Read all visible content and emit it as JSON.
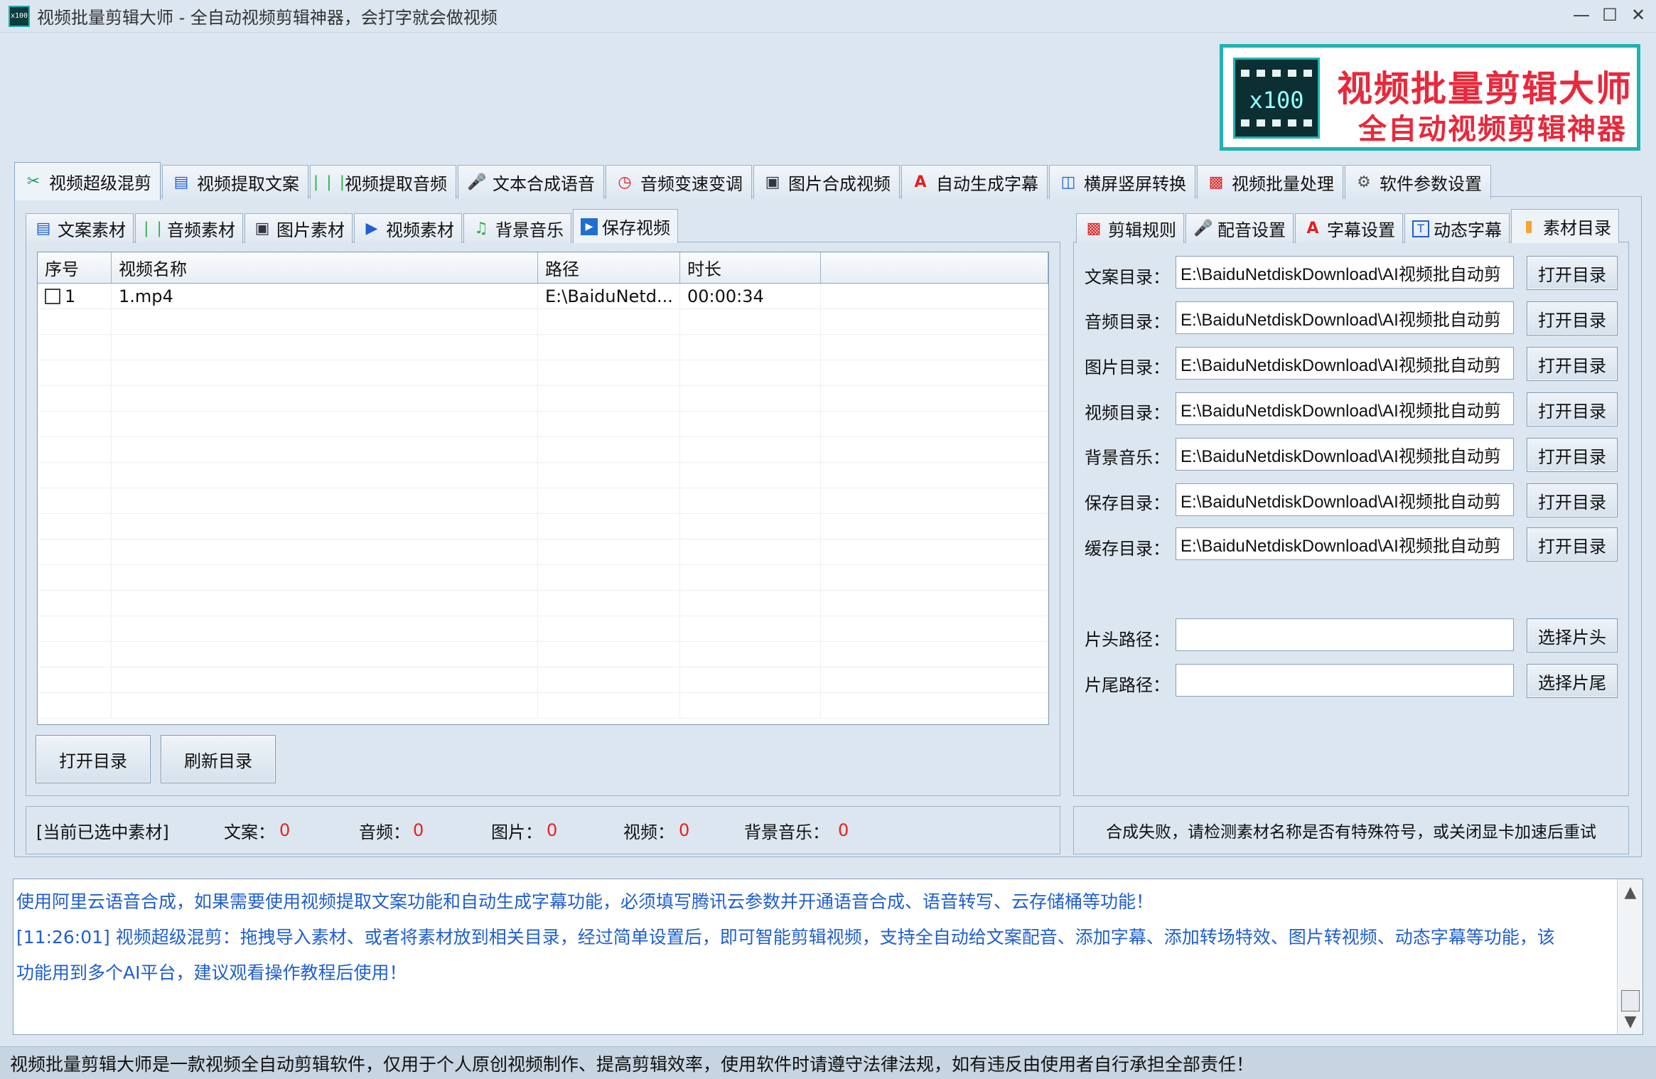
{
  "window": {
    "title": "视频批量剪辑大师 - 全自动视频剪辑神器，会打字就会做视频",
    "icon_text": "x100"
  },
  "logo": {
    "badge": "x100",
    "title": "视频批量剪辑大师",
    "subtitle": "全自动视频剪辑神器"
  },
  "main_tabs": [
    {
      "label": "视频超级混剪",
      "icon": "scissors-icon",
      "active": true
    },
    {
      "label": "视频提取文案",
      "icon": "document-icon"
    },
    {
      "label": "视频提取音频",
      "icon": "waveform-icon"
    },
    {
      "label": "文本合成语音",
      "icon": "microphone-icon"
    },
    {
      "label": "音频变速变调",
      "icon": "speedometer-icon"
    },
    {
      "label": "图片合成视频",
      "icon": "image-icon"
    },
    {
      "label": "自动生成字幕",
      "icon": "font-icon"
    },
    {
      "label": "横屏竖屏转换",
      "icon": "rotate-screen-icon"
    },
    {
      "label": "视频批量处理",
      "icon": "film-icon"
    },
    {
      "label": "软件参数设置",
      "icon": "gear-icon"
    }
  ],
  "sub_tabs": [
    {
      "label": "文案素材",
      "icon": "document-icon"
    },
    {
      "label": "音频素材",
      "icon": "waveform-icon"
    },
    {
      "label": "图片素材",
      "icon": "image-icon"
    },
    {
      "label": "视频素材",
      "icon": "play-icon"
    },
    {
      "label": "背景音乐",
      "icon": "music-note-icon"
    },
    {
      "label": "保存视频",
      "icon": "play-box-icon",
      "active": true
    }
  ],
  "table": {
    "columns": [
      "序号",
      "视频名称",
      "路径",
      "时长",
      ""
    ],
    "rows": [
      {
        "index": "1",
        "name": "1.mp4",
        "path": "E:\\BaiduNetd...",
        "duration": "00:00:34"
      }
    ]
  },
  "left_buttons": {
    "open_dir": "打开目录",
    "refresh_dir": "刷新目录"
  },
  "selected_bar": {
    "title": "[当前已选中素材]",
    "copy_label": "文案：",
    "copy_value": "0",
    "audio_label": "音频：",
    "audio_value": "0",
    "image_label": "图片：",
    "image_value": "0",
    "video_label": "视频：",
    "video_value": "0",
    "bgm_label": "背景音乐：",
    "bgm_value": "0"
  },
  "right_tabs": [
    {
      "label": "剪辑规则",
      "icon": "film-icon"
    },
    {
      "label": "配音设置",
      "icon": "microphone-icon"
    },
    {
      "label": "字幕设置",
      "icon": "font-icon"
    },
    {
      "label": "动态字幕",
      "icon": "text-box-icon"
    },
    {
      "label": "素材目录",
      "icon": "folder-icon",
      "active": true
    }
  ],
  "directories": [
    {
      "label": "文案目录：",
      "value": "E:\\BaiduNetdiskDownload\\AI视频批自动剪",
      "button": "打开目录"
    },
    {
      "label": "音频目录：",
      "value": "E:\\BaiduNetdiskDownload\\AI视频批自动剪",
      "button": "打开目录"
    },
    {
      "label": "图片目录：",
      "value": "E:\\BaiduNetdiskDownload\\AI视频批自动剪",
      "button": "打开目录"
    },
    {
      "label": "视频目录：",
      "value": "E:\\BaiduNetdiskDownload\\AI视频批自动剪",
      "button": "打开目录"
    },
    {
      "label": "背景音乐：",
      "value": "E:\\BaiduNetdiskDownload\\AI视频批自动剪",
      "button": "打开目录"
    },
    {
      "label": "保存目录：",
      "value": "E:\\BaiduNetdiskDownload\\AI视频批自动剪",
      "button": "打开目录"
    },
    {
      "label": "缓存目录：",
      "value": "E:\\BaiduNetdiskDownload\\AI视频批自动剪",
      "button": "打开目录"
    }
  ],
  "clips": [
    {
      "label": "片头路径：",
      "value": "",
      "button": "选择片头"
    },
    {
      "label": "片尾路径：",
      "value": "",
      "button": "选择片尾"
    }
  ],
  "status_right": "合成失败，请检测素材名称是否有特殊符号，或关闭显卡加速后重试",
  "log": {
    "line1": "使用阿里云语音合成，如果需要使用视频提取文案功能和自动生成字幕功能，必须填写腾讯云参数并开通语音合成、语音转写、云存储桶等功能！",
    "line2": "[11:26:01] 视频超级混剪：拖拽导入素材、或者将素材放到相关目录，经过简单设置后，即可智能剪辑视频，支持全自动给文案配音、添加字幕、添加转场特效、图片转视频、动态字幕等功能，该",
    "line3": "功能用到多个AI平台，建议观看操作教程后使用！"
  },
  "footer": "视频批量剪辑大师是一款视频全自动剪辑软件，仅用于个人原创视频制作、提高剪辑效率，使用软件时请遵守法律法规，如有违反由使用者自行承担全部责任！",
  "colors": {
    "accent": "#1fb3b3",
    "brand_red": "#e8283b",
    "log_text": "#1f5fd0",
    "counter_red": "#e82020",
    "background": "#dce6f0"
  }
}
